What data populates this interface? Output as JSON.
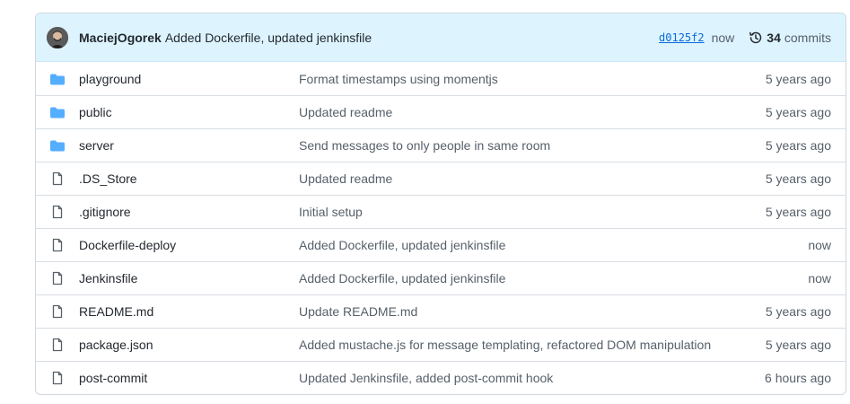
{
  "latest_commit": {
    "author": "MaciejOgorek",
    "message": "Added Dockerfile, updated jenkinsfile",
    "sha": "d0125f2",
    "time": "now",
    "commit_count": "34",
    "commits_label": "commits"
  },
  "files": [
    {
      "type": "folder",
      "icon": "folder-icon",
      "name": "playground",
      "message": "Format timestamps using momentjs",
      "age": "5 years ago"
    },
    {
      "type": "folder",
      "icon": "folder-icon",
      "name": "public",
      "message": "Updated readme",
      "age": "5 years ago"
    },
    {
      "type": "folder",
      "icon": "folder-icon",
      "name": "server",
      "message": "Send messages to only people in same room",
      "age": "5 years ago"
    },
    {
      "type": "file",
      "icon": "file-icon",
      "name": ".DS_Store",
      "message": "Updated readme",
      "age": "5 years ago"
    },
    {
      "type": "file",
      "icon": "file-icon",
      "name": ".gitignore",
      "message": "Initial setup",
      "age": "5 years ago"
    },
    {
      "type": "file",
      "icon": "file-icon",
      "name": "Dockerfile-deploy",
      "message": "Added Dockerfile, updated jenkinsfile",
      "age": "now"
    },
    {
      "type": "file",
      "icon": "file-icon",
      "name": "Jenkinsfile",
      "message": "Added Dockerfile, updated jenkinsfile",
      "age": "now"
    },
    {
      "type": "file",
      "icon": "file-icon",
      "name": "README.md",
      "message": "Update README.md",
      "age": "5 years ago"
    },
    {
      "type": "file",
      "icon": "file-icon",
      "name": "package.json",
      "message": "Added mustache.js for message templating, refactored DOM manipulation",
      "age": "5 years ago"
    },
    {
      "type": "file",
      "icon": "file-icon",
      "name": "post-commit",
      "message": "Updated Jenkinsfile, added post-commit hook",
      "age": "6 hours ago"
    }
  ],
  "colors": {
    "header_bg": "#ddf4ff",
    "folder": "#54aeff",
    "file_icon": "#57606a",
    "link": "#0969da",
    "border": "#d0d7de"
  }
}
